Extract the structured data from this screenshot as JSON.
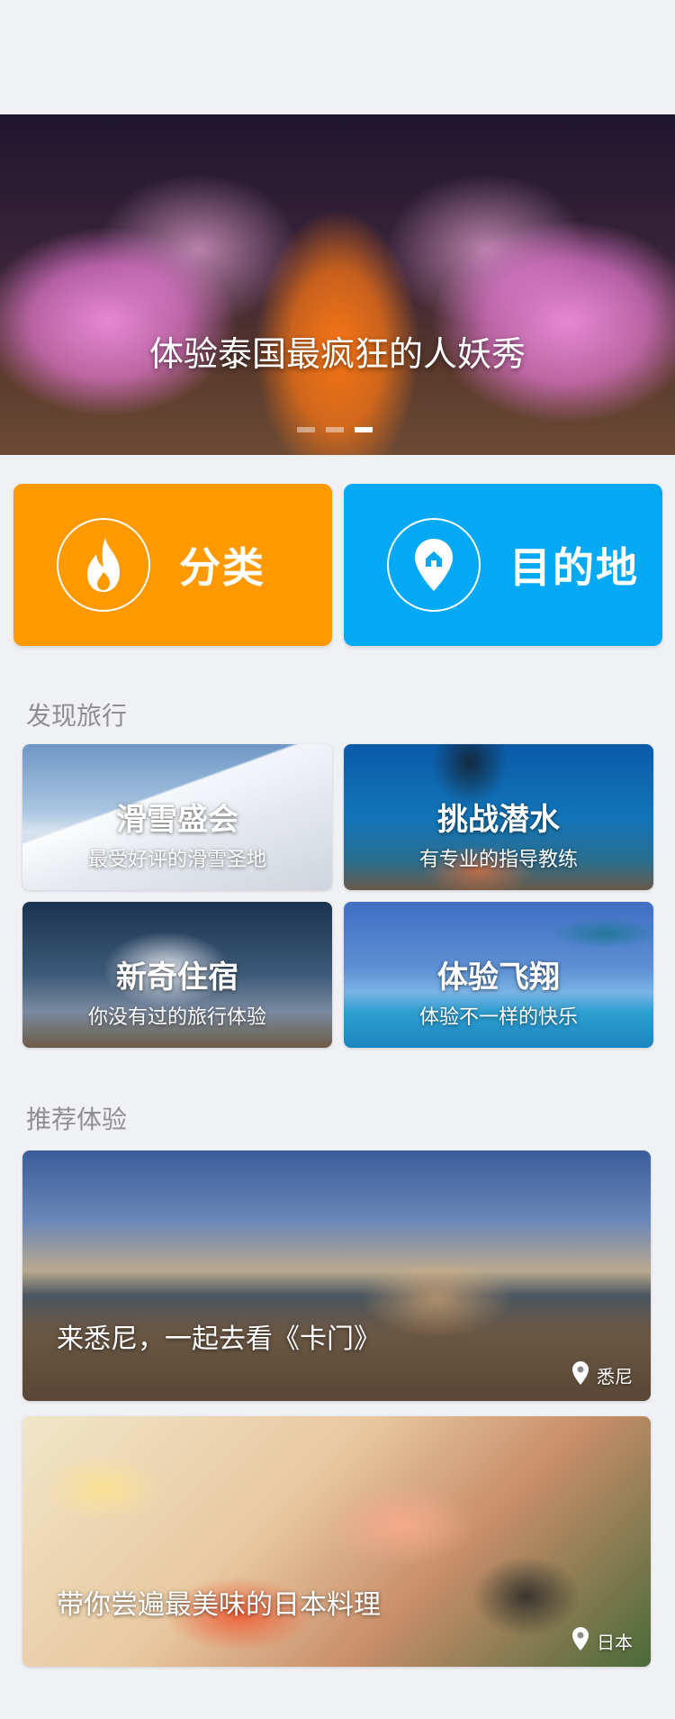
{
  "banner": {
    "caption": "体验泰国最疯狂的人妖秀",
    "dots": 3,
    "active_index": 2
  },
  "quick_buttons": [
    {
      "label": "分类",
      "icon": "flame-icon",
      "color": "#ff9900"
    },
    {
      "label": "目的地",
      "icon": "location-pin-icon",
      "color": "#03a9f4"
    }
  ],
  "discover": {
    "title": "发现旅行",
    "cards": [
      {
        "title": "滑雪盛会",
        "subtitle": "最受好评的滑雪圣地"
      },
      {
        "title": "挑战潜水",
        "subtitle": "有专业的指导教练"
      },
      {
        "title": "新奇住宿",
        "subtitle": "你没有过的旅行体验"
      },
      {
        "title": "体验飞翔",
        "subtitle": "体验不一样的快乐"
      }
    ]
  },
  "recommend": {
    "title": "推荐体验",
    "items": [
      {
        "title": "来悉尼，一起去看《卡门》",
        "location": "悉尼"
      },
      {
        "title": "带你尝遍最美味的日本料理",
        "location": "日本"
      }
    ]
  }
}
